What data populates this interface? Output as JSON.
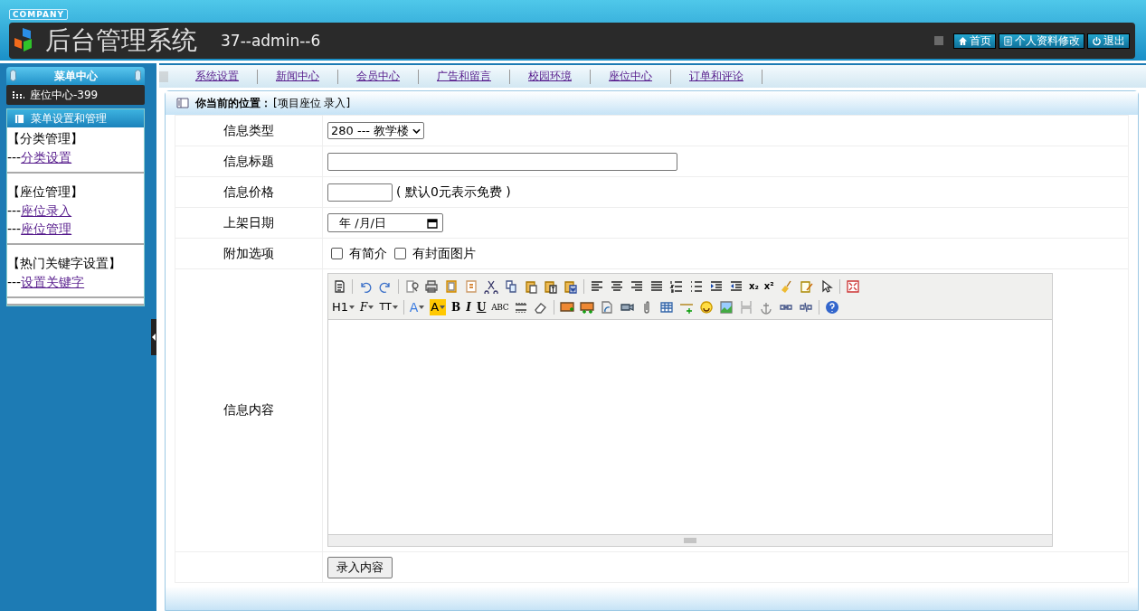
{
  "header": {
    "company": "COMPANY",
    "title": "后台管理系统",
    "user": "37--admin--6",
    "buttons": [
      {
        "kind": "home",
        "label": "首页"
      },
      {
        "kind": "profile",
        "label": "个人资料修改"
      },
      {
        "kind": "logout",
        "label": "退出"
      }
    ]
  },
  "sidebar": {
    "title": "菜单中心",
    "current": "座位中心-399",
    "section": "菜单设置和管理",
    "groups": [
      {
        "title": "【分类管理】",
        "links": [
          {
            "prefix": "---",
            "label": "分类设置"
          }
        ]
      },
      {
        "title": "【座位管理】",
        "links": [
          {
            "prefix": "---",
            "label": "座位录入"
          },
          {
            "prefix": "---",
            "label": "座位管理"
          }
        ]
      },
      {
        "title": "【热门关键字设置】",
        "links": [
          {
            "prefix": "---",
            "label": "设置关键字"
          }
        ]
      }
    ]
  },
  "nav": [
    "系统设置",
    "新闻中心",
    "会员中心",
    "广告和留言",
    "校园环境",
    "座位中心",
    "订单和评论"
  ],
  "breadcrumb": {
    "label": "你当前的位置：",
    "path": "[项目座位 录入]"
  },
  "form": [
    {
      "kind": "select",
      "label": "信息类型",
      "value": "280 --- 教学楼"
    },
    {
      "kind": "text",
      "label": "信息标题"
    },
    {
      "kind": "price",
      "label": "信息价格",
      "note": "( 默认0元表示免费 )"
    },
    {
      "kind": "date",
      "label": "上架日期",
      "value": "年 /月/日"
    },
    {
      "kind": "checks",
      "label": "附加选项",
      "options": [
        {
          "label": "有简介",
          "checked": false
        },
        {
          "label": "有封面图片",
          "checked": false
        }
      ]
    },
    {
      "kind": "editor",
      "label": "信息内容",
      "toolbar_labels": [
        "x₂",
        "x²",
        "H1",
        "F",
        "TT",
        "A",
        "A",
        "B",
        "I",
        "U",
        "ABC"
      ]
    },
    {
      "kind": "submit",
      "button": "录入内容"
    }
  ]
}
